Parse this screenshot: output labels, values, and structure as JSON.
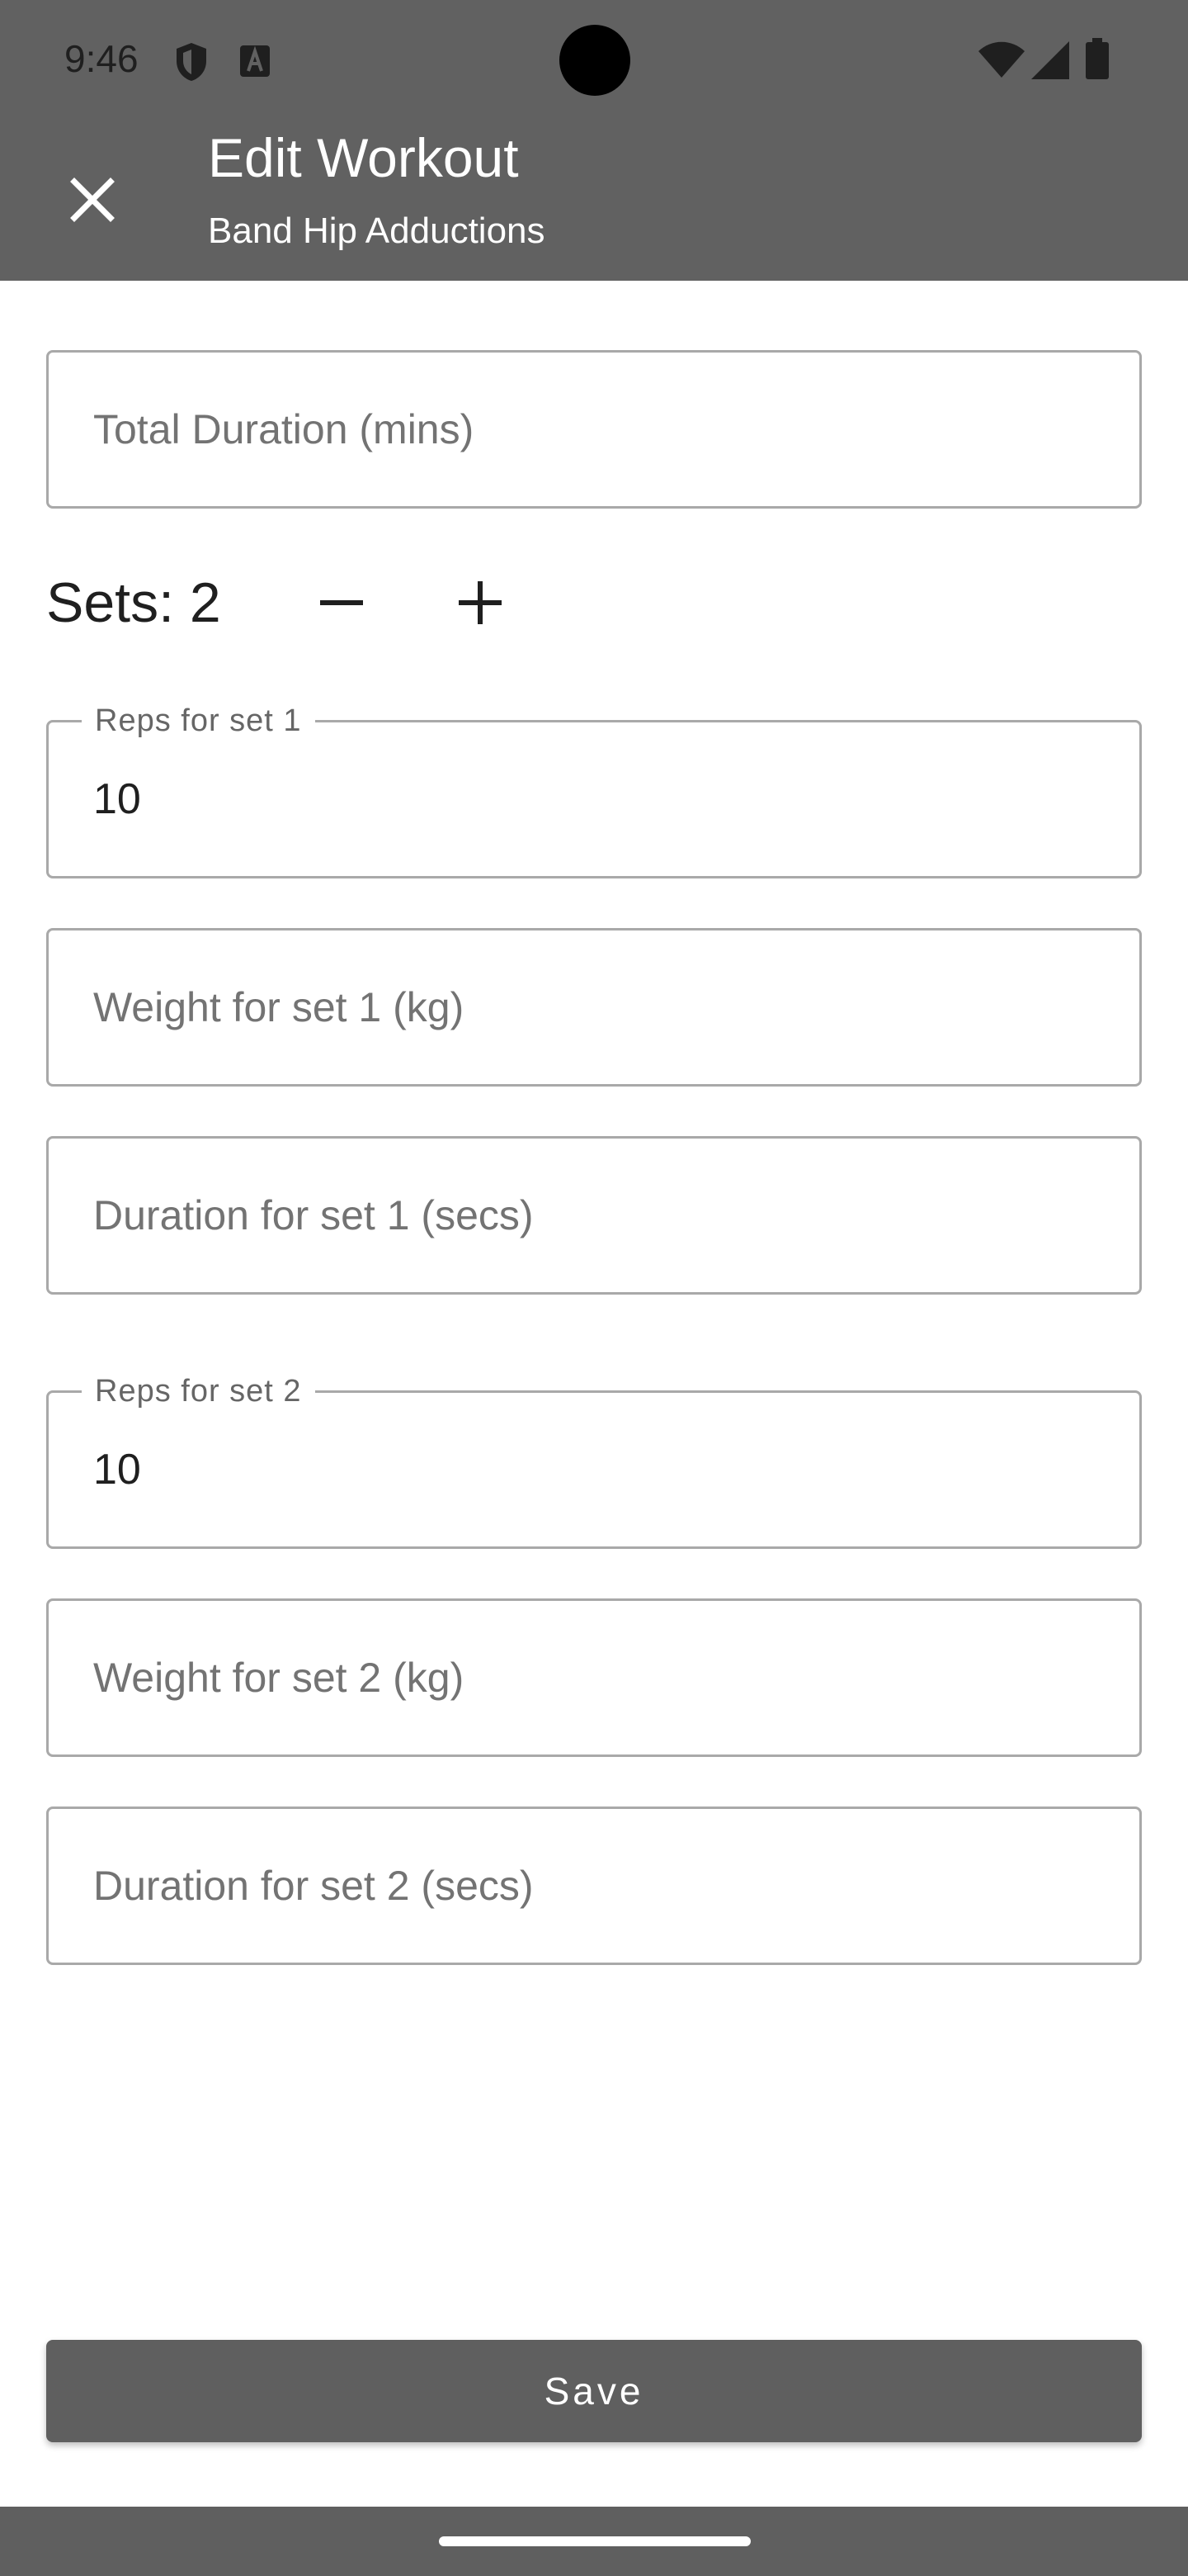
{
  "status_bar": {
    "time": "9:46",
    "icons": [
      "shield-icon",
      "a-letter-icon",
      "wifi-icon",
      "cellular-icon",
      "battery-icon"
    ]
  },
  "app_bar": {
    "title": "Edit Workout",
    "subtitle": "Band Hip Adductions",
    "close_icon": "close-icon",
    "background_color": "#616161"
  },
  "form": {
    "total_duration": {
      "placeholder": "Total Duration (mins)",
      "value": ""
    },
    "sets": {
      "label": "Sets: 2",
      "count": 2,
      "decrement_icon": "minus-icon",
      "increment_icon": "plus-icon"
    },
    "set_fields": [
      {
        "reps": {
          "label": "Reps for set 1",
          "value": "10"
        },
        "weight": {
          "placeholder": "Weight for set 1 (kg)",
          "value": ""
        },
        "duration": {
          "placeholder": "Duration for set 1 (secs)",
          "value": ""
        }
      },
      {
        "reps": {
          "label": "Reps for set 2",
          "value": "10"
        },
        "weight": {
          "placeholder": "Weight for set 2 (kg)",
          "value": ""
        },
        "duration": {
          "placeholder": "Duration for set 2 (secs)",
          "value": ""
        }
      }
    ]
  },
  "save_button": {
    "label": "Save",
    "color": "#5f5f5f"
  }
}
